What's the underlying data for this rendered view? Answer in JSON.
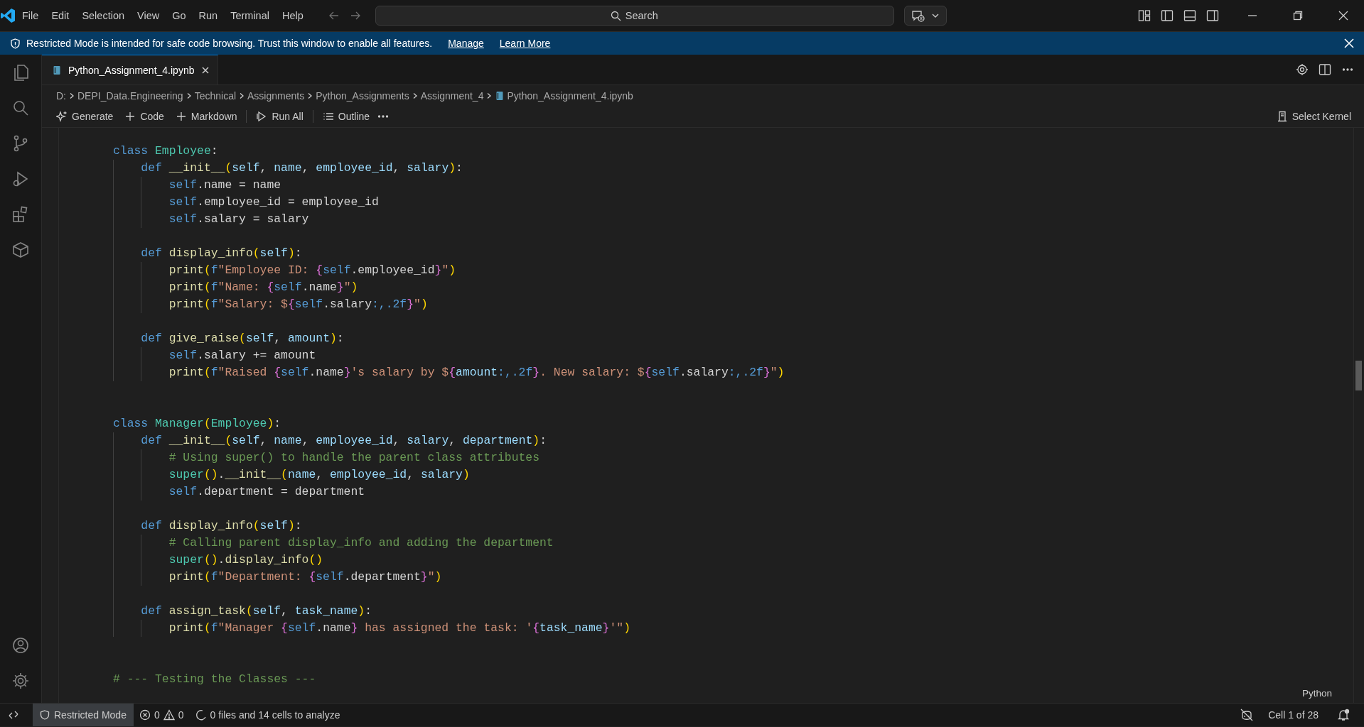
{
  "title_bar": {
    "menu": [
      "File",
      "Edit",
      "Selection",
      "View",
      "Go",
      "Run",
      "Terminal",
      "Help"
    ],
    "search": {
      "placeholder": "Search"
    }
  },
  "banner": {
    "message": "Restricted Mode is intended for safe code browsing. Trust this window to enable all features.",
    "links": [
      "Manage",
      "Learn More"
    ]
  },
  "tabs": [
    {
      "label": "Python_Assignment_4.ipynb",
      "selected": true
    }
  ],
  "breadcrumb": [
    "D:",
    "DEPI_Data.Engineering",
    "Technical",
    "Assignments",
    "Python_Assignments",
    "Assignment_4",
    "Python_Assignment_4.ipynb"
  ],
  "toolbar": [
    {
      "kind": "generate",
      "label": "Generate"
    },
    {
      "kind": "add",
      "label": "Code"
    },
    {
      "kind": "add",
      "label": "Markdown"
    },
    {
      "kind": "run",
      "label": "Run All"
    },
    {
      "kind": "outline",
      "label": "Outline"
    }
  ],
  "kernel": "Select Kernel",
  "cell": {
    "language": "Python",
    "lines": [
      {
        "kind": "code",
        "tokens": [
          {
            "kind": "kw",
            "text": "class"
          },
          {
            "kind": "cls",
            "text": " Employee"
          },
          {
            "kind": "plain",
            "text": ":"
          }
        ],
        "children": [
          {
            "kind": "code",
            "tokens": [
              {
                "kind": "kw",
                "text": "def"
              },
              {
                "kind": "fn",
                "text": " __init__"
              },
              {
                "kind": "paren",
                "text": "("
              },
              {
                "kind": "var",
                "text": "self"
              },
              {
                "kind": "plain",
                "text": ", "
              },
              {
                "kind": "var",
                "text": "name"
              },
              {
                "kind": "plain",
                "text": ", "
              },
              {
                "kind": "var",
                "text": "employee_id"
              },
              {
                "kind": "plain",
                "text": ", "
              },
              {
                "kind": "var",
                "text": "salary"
              },
              {
                "kind": "paren",
                "text": ")"
              },
              {
                "kind": "plain",
                "text": ":"
              }
            ],
            "children": [
              {
                "kind": "code",
                "tokens": [
                  {
                    "kind": "kw",
                    "text": "self"
                  },
                  {
                    "kind": "plain",
                    "text": ".name = name"
                  }
                ]
              },
              {
                "kind": "code",
                "tokens": [
                  {
                    "kind": "kw",
                    "text": "self"
                  },
                  {
                    "kind": "plain",
                    "text": ".employee_id = employee_id"
                  }
                ]
              },
              {
                "kind": "code",
                "tokens": [
                  {
                    "kind": "kw",
                    "text": "self"
                  },
                  {
                    "kind": "plain",
                    "text": ".salary = salary"
                  }
                ]
              }
            ]
          },
          {
            "kind": "blank"
          },
          {
            "kind": "code",
            "tokens": [
              {
                "kind": "kw",
                "text": "def"
              },
              {
                "kind": "fn",
                "text": " display_info"
              },
              {
                "kind": "paren",
                "text": "("
              },
              {
                "kind": "var",
                "text": "self"
              },
              {
                "kind": "paren",
                "text": ")"
              },
              {
                "kind": "plain",
                "text": ":"
              }
            ],
            "children": [
              {
                "kind": "code",
                "tokens": [
                  {
                    "kind": "fn",
                    "text": "print"
                  },
                  {
                    "kind": "paren",
                    "text": "("
                  },
                  {
                    "kind": "kw",
                    "text": "f"
                  },
                  {
                    "kind": "str",
                    "text": "\"Employee ID: "
                  },
                  {
                    "kind": "brace",
                    "text": "{"
                  },
                  {
                    "kind": "kw",
                    "text": "self"
                  },
                  {
                    "kind": "plain",
                    "text": ".employee_id"
                  },
                  {
                    "kind": "brace",
                    "text": "}"
                  },
                  {
                    "kind": "str",
                    "text": "\""
                  },
                  {
                    "kind": "paren",
                    "text": ")"
                  }
                ]
              },
              {
                "kind": "code",
                "tokens": [
                  {
                    "kind": "fn",
                    "text": "print"
                  },
                  {
                    "kind": "paren",
                    "text": "("
                  },
                  {
                    "kind": "kw",
                    "text": "f"
                  },
                  {
                    "kind": "str",
                    "text": "\"Name: "
                  },
                  {
                    "kind": "brace",
                    "text": "{"
                  },
                  {
                    "kind": "kw",
                    "text": "self"
                  },
                  {
                    "kind": "plain",
                    "text": ".name"
                  },
                  {
                    "kind": "brace",
                    "text": "}"
                  },
                  {
                    "kind": "str",
                    "text": "\""
                  },
                  {
                    "kind": "paren",
                    "text": ")"
                  }
                ]
              },
              {
                "kind": "code",
                "tokens": [
                  {
                    "kind": "fn",
                    "text": "print"
                  },
                  {
                    "kind": "paren",
                    "text": "("
                  },
                  {
                    "kind": "kw",
                    "text": "f"
                  },
                  {
                    "kind": "str",
                    "text": "\"Salary: $"
                  },
                  {
                    "kind": "brace",
                    "text": "{"
                  },
                  {
                    "kind": "kw",
                    "text": "self"
                  },
                  {
                    "kind": "plain",
                    "text": ".salary"
                  },
                  {
                    "kind": "kw",
                    "text": ":,.2f"
                  },
                  {
                    "kind": "brace",
                    "text": "}"
                  },
                  {
                    "kind": "str",
                    "text": "\""
                  },
                  {
                    "kind": "paren",
                    "text": ")"
                  }
                ]
              }
            ]
          },
          {
            "kind": "blank"
          },
          {
            "kind": "code",
            "tokens": [
              {
                "kind": "kw",
                "text": "def"
              },
              {
                "kind": "fn",
                "text": " give_raise"
              },
              {
                "kind": "paren",
                "text": "("
              },
              {
                "kind": "var",
                "text": "self"
              },
              {
                "kind": "plain",
                "text": ", "
              },
              {
                "kind": "var",
                "text": "amount"
              },
              {
                "kind": "paren",
                "text": ")"
              },
              {
                "kind": "plain",
                "text": ":"
              }
            ],
            "children": [
              {
                "kind": "code",
                "tokens": [
                  {
                    "kind": "kw",
                    "text": "self"
                  },
                  {
                    "kind": "plain",
                    "text": ".salary += amount"
                  }
                ]
              },
              {
                "kind": "code",
                "tokens": [
                  {
                    "kind": "fn",
                    "text": "print"
                  },
                  {
                    "kind": "paren",
                    "text": "("
                  },
                  {
                    "kind": "kw",
                    "text": "f"
                  },
                  {
                    "kind": "str",
                    "text": "\"Raised "
                  },
                  {
                    "kind": "brace",
                    "text": "{"
                  },
                  {
                    "kind": "kw",
                    "text": "self"
                  },
                  {
                    "kind": "plain",
                    "text": ".name"
                  },
                  {
                    "kind": "brace",
                    "text": "}"
                  },
                  {
                    "kind": "str",
                    "text": "'s salary by $"
                  },
                  {
                    "kind": "brace",
                    "text": "{"
                  },
                  {
                    "kind": "var",
                    "text": "amount"
                  },
                  {
                    "kind": "kw",
                    "text": ":,.2f"
                  },
                  {
                    "kind": "brace",
                    "text": "}"
                  },
                  {
                    "kind": "str",
                    "text": ". New salary: $"
                  },
                  {
                    "kind": "brace",
                    "text": "{"
                  },
                  {
                    "kind": "kw",
                    "text": "self"
                  },
                  {
                    "kind": "plain",
                    "text": ".salary"
                  },
                  {
                    "kind": "kw",
                    "text": ":,.2f"
                  },
                  {
                    "kind": "brace",
                    "text": "}"
                  },
                  {
                    "kind": "str",
                    "text": "\""
                  },
                  {
                    "kind": "paren",
                    "text": ")"
                  }
                ]
              }
            ]
          }
        ]
      },
      {
        "kind": "blank"
      },
      {
        "kind": "blank"
      },
      {
        "kind": "code",
        "tokens": [
          {
            "kind": "kw",
            "text": "class"
          },
          {
            "kind": "cls",
            "text": " Manager"
          },
          {
            "kind": "paren",
            "text": "("
          },
          {
            "kind": "cls",
            "text": "Employee"
          },
          {
            "kind": "paren",
            "text": ")"
          },
          {
            "kind": "plain",
            "text": ":"
          }
        ],
        "children": [
          {
            "kind": "code",
            "tokens": [
              {
                "kind": "kw",
                "text": "def"
              },
              {
                "kind": "fn",
                "text": " __init__"
              },
              {
                "kind": "paren",
                "text": "("
              },
              {
                "kind": "var",
                "text": "self"
              },
              {
                "kind": "plain",
                "text": ", "
              },
              {
                "kind": "var",
                "text": "name"
              },
              {
                "kind": "plain",
                "text": ", "
              },
              {
                "kind": "var",
                "text": "employee_id"
              },
              {
                "kind": "plain",
                "text": ", "
              },
              {
                "kind": "var",
                "text": "salary"
              },
              {
                "kind": "plain",
                "text": ", "
              },
              {
                "kind": "var",
                "text": "department"
              },
              {
                "kind": "paren",
                "text": ")"
              },
              {
                "kind": "plain",
                "text": ":"
              }
            ],
            "children": [
              {
                "kind": "code",
                "tokens": [
                  {
                    "kind": "comment",
                    "text": "# Using super() to handle the parent class attributes"
                  }
                ]
              },
              {
                "kind": "code",
                "tokens": [
                  {
                    "kind": "cls",
                    "text": "super"
                  },
                  {
                    "kind": "paren",
                    "text": "()"
                  },
                  {
                    "kind": "plain",
                    "text": "."
                  },
                  {
                    "kind": "fn",
                    "text": "__init__"
                  },
                  {
                    "kind": "paren",
                    "text": "("
                  },
                  {
                    "kind": "var",
                    "text": "name"
                  },
                  {
                    "kind": "plain",
                    "text": ", "
                  },
                  {
                    "kind": "var",
                    "text": "employee_id"
                  },
                  {
                    "kind": "plain",
                    "text": ", "
                  },
                  {
                    "kind": "var",
                    "text": "salary"
                  },
                  {
                    "kind": "paren",
                    "text": ")"
                  }
                ]
              },
              {
                "kind": "code",
                "tokens": [
                  {
                    "kind": "kw",
                    "text": "self"
                  },
                  {
                    "kind": "plain",
                    "text": ".department = department"
                  }
                ]
              }
            ]
          },
          {
            "kind": "blank"
          },
          {
            "kind": "code",
            "tokens": [
              {
                "kind": "kw",
                "text": "def"
              },
              {
                "kind": "fn",
                "text": " display_info"
              },
              {
                "kind": "paren",
                "text": "("
              },
              {
                "kind": "var",
                "text": "self"
              },
              {
                "kind": "paren",
                "text": ")"
              },
              {
                "kind": "plain",
                "text": ":"
              }
            ],
            "children": [
              {
                "kind": "code",
                "tokens": [
                  {
                    "kind": "comment",
                    "text": "# Calling parent display_info and adding the department"
                  }
                ]
              },
              {
                "kind": "code",
                "tokens": [
                  {
                    "kind": "cls",
                    "text": "super"
                  },
                  {
                    "kind": "paren",
                    "text": "()"
                  },
                  {
                    "kind": "plain",
                    "text": "."
                  },
                  {
                    "kind": "fn",
                    "text": "display_info"
                  },
                  {
                    "kind": "paren",
                    "text": "()"
                  }
                ]
              },
              {
                "kind": "code",
                "tokens": [
                  {
                    "kind": "fn",
                    "text": "print"
                  },
                  {
                    "kind": "paren",
                    "text": "("
                  },
                  {
                    "kind": "kw",
                    "text": "f"
                  },
                  {
                    "kind": "str",
                    "text": "\"Department: "
                  },
                  {
                    "kind": "brace",
                    "text": "{"
                  },
                  {
                    "kind": "kw",
                    "text": "self"
                  },
                  {
                    "kind": "plain",
                    "text": ".department"
                  },
                  {
                    "kind": "brace",
                    "text": "}"
                  },
                  {
                    "kind": "str",
                    "text": "\""
                  },
                  {
                    "kind": "paren",
                    "text": ")"
                  }
                ]
              }
            ]
          },
          {
            "kind": "blank"
          },
          {
            "kind": "code",
            "tokens": [
              {
                "kind": "kw",
                "text": "def"
              },
              {
                "kind": "fn",
                "text": " assign_task"
              },
              {
                "kind": "paren",
                "text": "("
              },
              {
                "kind": "var",
                "text": "self"
              },
              {
                "kind": "plain",
                "text": ", "
              },
              {
                "kind": "var",
                "text": "task_name"
              },
              {
                "kind": "paren",
                "text": ")"
              },
              {
                "kind": "plain",
                "text": ":"
              }
            ],
            "children": [
              {
                "kind": "code",
                "tokens": [
                  {
                    "kind": "fn",
                    "text": "print"
                  },
                  {
                    "kind": "paren",
                    "text": "("
                  },
                  {
                    "kind": "kw",
                    "text": "f"
                  },
                  {
                    "kind": "str",
                    "text": "\"Manager "
                  },
                  {
                    "kind": "brace",
                    "text": "{"
                  },
                  {
                    "kind": "kw",
                    "text": "self"
                  },
                  {
                    "kind": "plain",
                    "text": ".name"
                  },
                  {
                    "kind": "brace",
                    "text": "}"
                  },
                  {
                    "kind": "str",
                    "text": " has assigned the task: '"
                  },
                  {
                    "kind": "brace",
                    "text": "{"
                  },
                  {
                    "kind": "var",
                    "text": "task_name"
                  },
                  {
                    "kind": "brace",
                    "text": "}"
                  },
                  {
                    "kind": "str",
                    "text": "'\""
                  },
                  {
                    "kind": "paren",
                    "text": ")"
                  }
                ]
              }
            ]
          }
        ]
      },
      {
        "kind": "blank"
      },
      {
        "kind": "blank"
      },
      {
        "kind": "code",
        "tokens": [
          {
            "kind": "comment",
            "text": "# --- Testing the Classes ---"
          }
        ]
      }
    ]
  },
  "status_bar": {
    "mode": "Restricted Mode",
    "errors": "0",
    "warnings": "0",
    "analysis": "0 files and 14 cells to analyze",
    "cell_position": "Cell 1 of 28"
  }
}
